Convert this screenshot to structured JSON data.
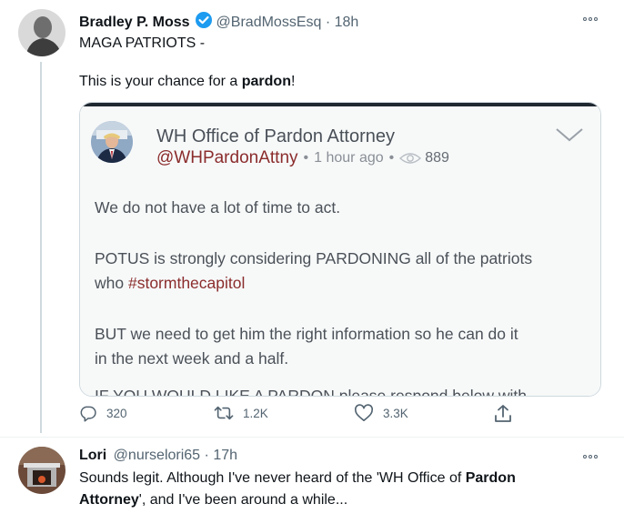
{
  "tweet1": {
    "name": "Bradley P. Moss",
    "handle": "@BradMossEsq",
    "dot": "·",
    "time": "18h",
    "line1": "MAGA PATRIOTS -",
    "line2_pre": "This is your chance for a ",
    "line2_bold": "pardon",
    "line2_post": "!",
    "embedded": {
      "name": "WH Office of Pardon Attorney",
      "handle": "@WHPardonAttny",
      "time": "1 hour ago",
      "views": "889",
      "p1": "We do not have a lot of time to act.",
      "p2a": "POTUS is strongly considering PARDONING all of the patriots",
      "p2b_pre": "who ",
      "p2b_hashtag": "#stormthecapitol",
      "p3a": "BUT we need to get him the right information so he can do it",
      "p3b": "in the next week and a half.",
      "p4_cut": "IF YOU WOULD LIKE A PARDON please respond below with"
    },
    "actions": {
      "replies": "320",
      "retweets": "1.2K",
      "likes": "3.3K"
    }
  },
  "tweet2": {
    "name": "Lori",
    "handle": "@nurselori65",
    "dot": "·",
    "time": "17h",
    "line1_pre": "Sounds legit. Although I've never heard of the 'WH Office of ",
    "line1_bold": "Pardon",
    "line2_bold": "Attorney",
    "line2_post": "', and I've been around a while..."
  },
  "colors": {
    "verified": "#1d9bf0",
    "secondary_text": "#536471",
    "hashtag": "#8b2c2c"
  }
}
